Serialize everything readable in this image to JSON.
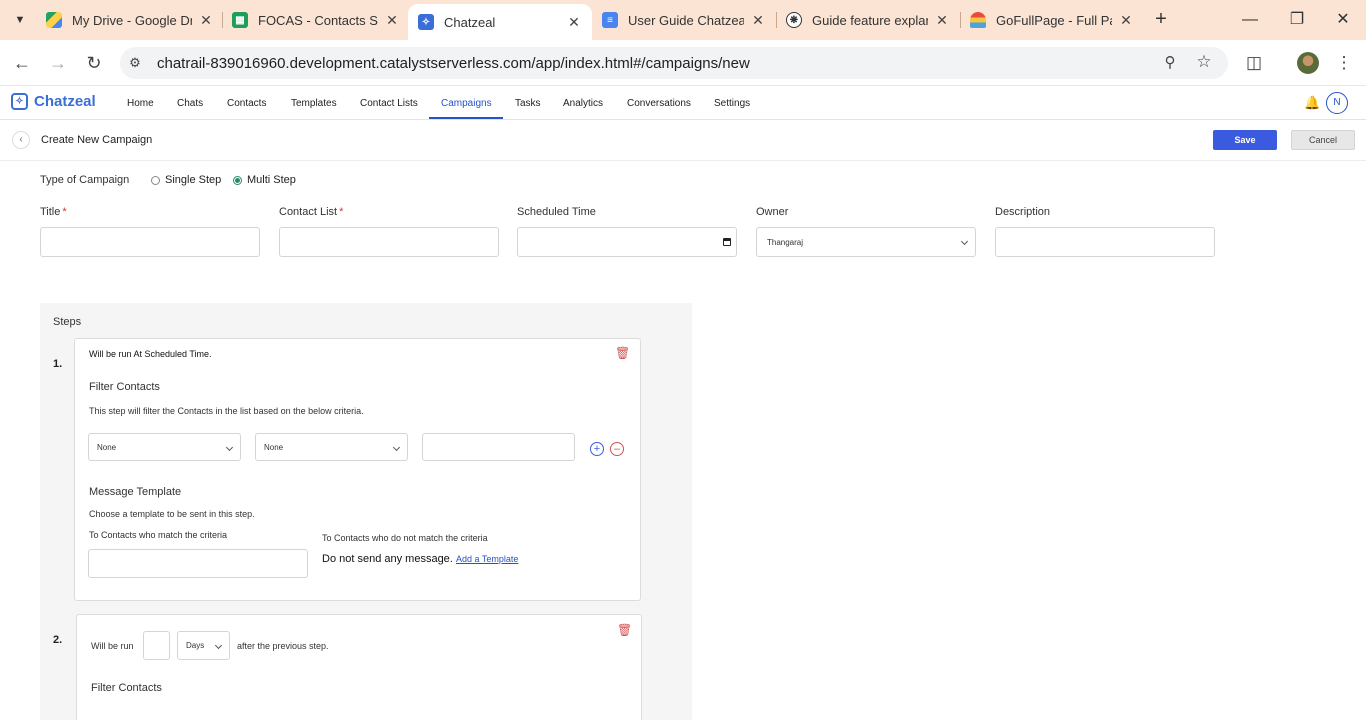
{
  "browser": {
    "tabs": [
      {
        "title": "My Drive - Google Dr",
        "icon": "google-drive-icon"
      },
      {
        "title": "FOCAS - Contacts Sa",
        "icon": "google-sheets-icon"
      },
      {
        "title": "Chatzeal",
        "icon": "chatzeal-icon"
      },
      {
        "title": "User Guide Chatzeal",
        "icon": "google-docs-icon"
      },
      {
        "title": "Guide feature explan",
        "icon": "chatgpt-icon"
      },
      {
        "title": "GoFullPage - Full Pag",
        "icon": "gofullpage-icon"
      }
    ],
    "url": "chatrail-839016960.development.catalystserverless.com/app/index.html#/campaigns/new"
  },
  "app": {
    "brand": "Chatzeal",
    "nav": [
      "Home",
      "Chats",
      "Contacts",
      "Templates",
      "Contact Lists",
      "Campaigns",
      "Tasks",
      "Analytics",
      "Conversations",
      "Settings"
    ],
    "active_nav": "Campaigns",
    "avatar_initial": "N"
  },
  "page": {
    "title": "Create New Campaign",
    "save_label": "Save",
    "cancel_label": "Cancel"
  },
  "form": {
    "type_label": "Type of Campaign",
    "type_options": [
      "Single Step",
      "Multi Step"
    ],
    "type_selected": "Multi Step",
    "title_label": "Title",
    "contact_list_label": "Contact List",
    "scheduled_time_label": "Scheduled Time",
    "owner_label": "Owner",
    "owner_value": "Thangaraj",
    "description_label": "Description",
    "required_mark": "*"
  },
  "steps": {
    "heading": "Steps",
    "step1": {
      "number": "1.",
      "run_text": "Will be run At Scheduled Time.",
      "filter_title": "Filter Contacts",
      "filter_desc": "This step will filter the Contacts in the list based on the below criteria.",
      "filter_field_1": "None",
      "filter_field_2": "None",
      "template_title": "Message Template",
      "template_desc": "Choose a template to be sent in this step.",
      "match_label": "To Contacts who match the criteria",
      "nomatch_label": "To Contacts who do not match the criteria",
      "nomatch_value": "Do not send any message.",
      "add_template_link": "Add a Template"
    },
    "step2": {
      "number": "2.",
      "run_prefix": "Will be run",
      "unit": "Days",
      "run_suffix": "after the previous step.",
      "filter_title": "Filter Contacts"
    }
  }
}
